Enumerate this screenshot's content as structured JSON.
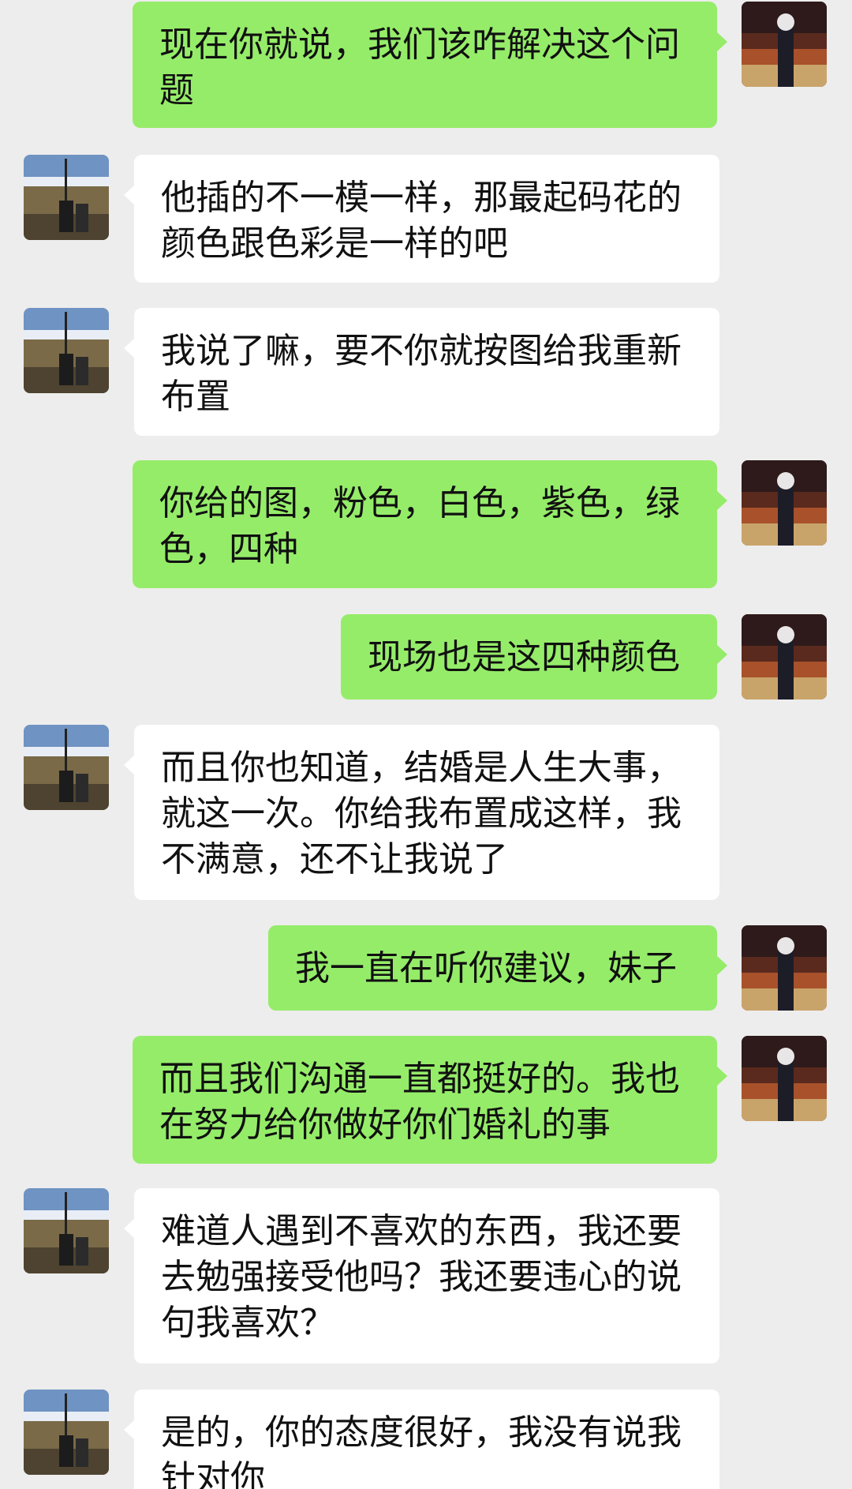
{
  "messages": [
    {
      "side": "right",
      "text": "现在你就说，我们该咋解决这个问题"
    },
    {
      "side": "left",
      "text": "他插的不一模一样，那最起码花的颜色跟色彩是一样的吧"
    },
    {
      "side": "left",
      "text": "我说了嘛，要不你就按图给我重新布置"
    },
    {
      "side": "right",
      "text": "你给的图，粉色，白色，紫色，绿色，四种"
    },
    {
      "side": "right",
      "text": "现场也是这四种颜色"
    },
    {
      "side": "left",
      "text": "而且你也知道，结婚是人生大事，就这一次。你给我布置成这样，我不满意，还不让我说了"
    },
    {
      "side": "right",
      "text": "我一直在听你建议，妹子"
    },
    {
      "side": "right",
      "text": "而且我们沟通一直都挺好的。我也在努力给你做好你们婚礼的事"
    },
    {
      "side": "left",
      "text": "难道人遇到不喜欢的东西，我还要去勉强接受他吗？我还要违心的说句我喜欢？"
    },
    {
      "side": "left",
      "text": "是的，你的态度很好，我没有说我针对你"
    }
  ],
  "avatars": {
    "self": "self-avatar-photo",
    "contact": "contact-avatar-landscape-photo"
  },
  "colors": {
    "background": "#ededed",
    "sent_bubble": "#95ec69",
    "received_bubble": "#ffffff",
    "text": "#111111"
  }
}
